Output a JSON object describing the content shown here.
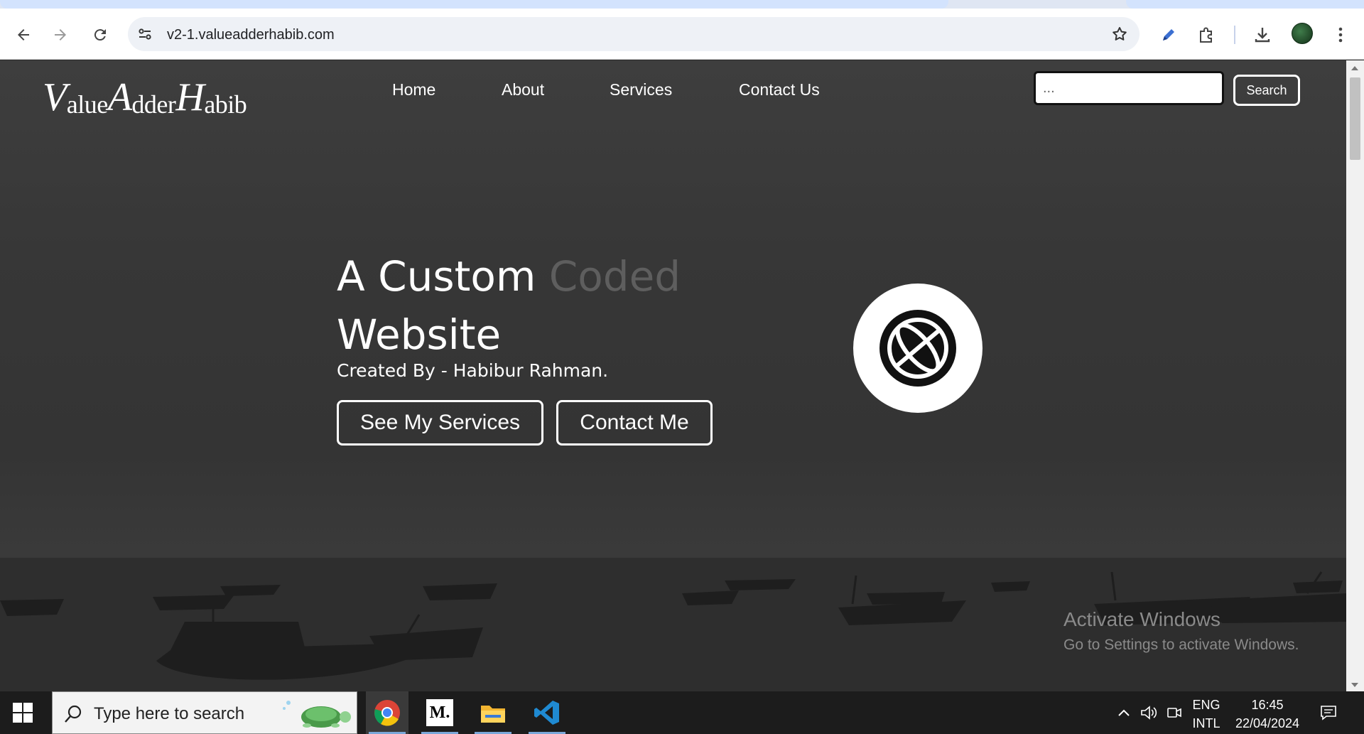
{
  "browser": {
    "url": "v2-1.valueadderhabib.com",
    "icons": [
      "back-icon",
      "forward-icon",
      "reload-icon",
      "site-info-icon",
      "bookmark-star-icon",
      "pen-icon",
      "extensions-icon",
      "download-icon",
      "menu-icon"
    ]
  },
  "site": {
    "logo_letters": {
      "v": "V",
      "alue": "alue",
      "a": "A",
      "dder": "dder",
      "h": "H",
      "abib": "abib"
    },
    "nav": {
      "home": "Home",
      "about": "About",
      "services": "Services",
      "contact": "Contact Us"
    },
    "search": {
      "placeholder": "...",
      "button": "Search"
    },
    "hero": {
      "line1_bright": "A Custom",
      "line1_dim": "Coded",
      "line2": "Website",
      "subtitle": "Created By - Habibur Rahman.",
      "btn_services": "See My Services",
      "btn_contact": "Contact Me",
      "globe_icon": "globe-icon"
    }
  },
  "watermark": {
    "title": "Activate Windows",
    "subtitle": "Go to Settings to activate Windows."
  },
  "taskbar": {
    "search_placeholder": "Type here to search",
    "apps": [
      "chrome-icon",
      "medium-icon",
      "file-explorer-icon",
      "vscode-icon"
    ],
    "medium_label": "M.",
    "lang_top": "ENG",
    "lang_bottom": "INTL",
    "time": "16:45",
    "date": "22/04/2024"
  }
}
